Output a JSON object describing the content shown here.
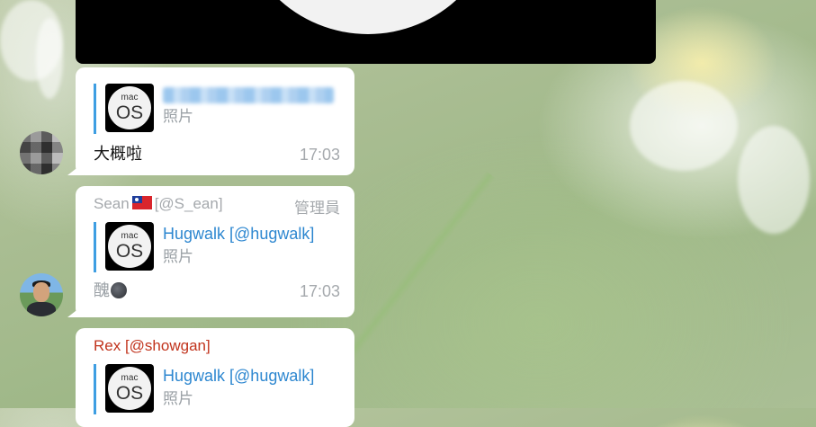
{
  "messages": [
    {
      "reply": {
        "author": "",
        "kind": "照片",
        "thumb_top": "mac",
        "thumb_main": "OS"
      },
      "text": "大概啦",
      "time": "17:03"
    },
    {
      "sender": {
        "name": "Sean",
        "handle": "[@S_ean]",
        "role": "管理員"
      },
      "reply": {
        "author": "Hugwalk [@hugwalk]",
        "kind": "照片",
        "thumb_top": "mac",
        "thumb_main": "OS"
      },
      "text": "醜",
      "time": "17:03"
    },
    {
      "sender": {
        "name": "Rex [@showgan]"
      },
      "reply": {
        "author": "Hugwalk [@hugwalk]",
        "kind": "照片",
        "thumb_top": "mac",
        "thumb_main": "OS"
      }
    }
  ],
  "icons": {
    "flag": "taiwan-flag-icon",
    "moon": "new-moon-face-icon"
  },
  "colors": {
    "reply_bar": "#3e9ee2",
    "reply_author": "#2d87d0",
    "sender_red": "#c1331c",
    "muted": "#a5a9ad"
  }
}
